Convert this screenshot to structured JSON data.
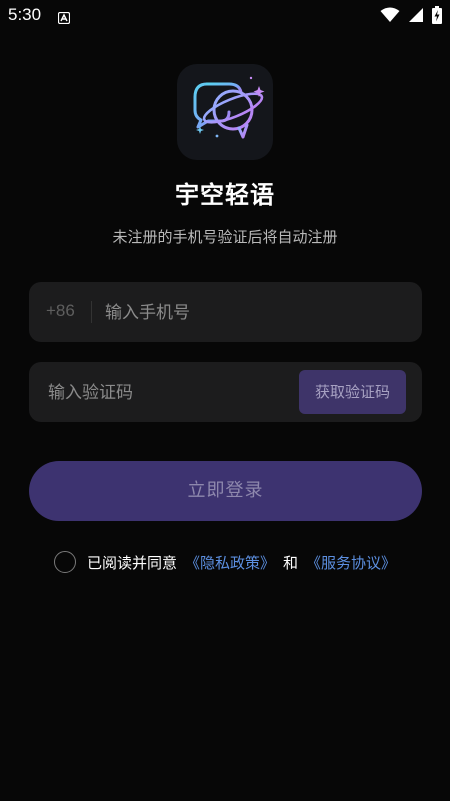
{
  "status_bar": {
    "time": "5:30",
    "notification_icon": "a-logo-icon",
    "wifi_icon": "wifi-icon",
    "signal_icon": "signal-icon",
    "battery_icon": "battery-charging-icon"
  },
  "app": {
    "logo_icon": "planet-chat-bubbles-icon",
    "title": "宇空轻语",
    "subtitle": "未注册的手机号验证后将自动注册"
  },
  "phone_field": {
    "country_code": "+86",
    "placeholder": "输入手机号",
    "value": ""
  },
  "code_field": {
    "placeholder": "输入验证码",
    "value": "",
    "get_code_label": "获取验证码"
  },
  "login": {
    "label": "立即登录"
  },
  "agreement": {
    "checked": false,
    "prefix": "已阅读并同意",
    "privacy_link": "《隐私政策》",
    "and": "和",
    "service_link": "《服务协议》"
  },
  "colors": {
    "background": "#070707",
    "field_background": "#1c1c1d",
    "accent": "#3d3370",
    "link": "#5c8fe0"
  }
}
